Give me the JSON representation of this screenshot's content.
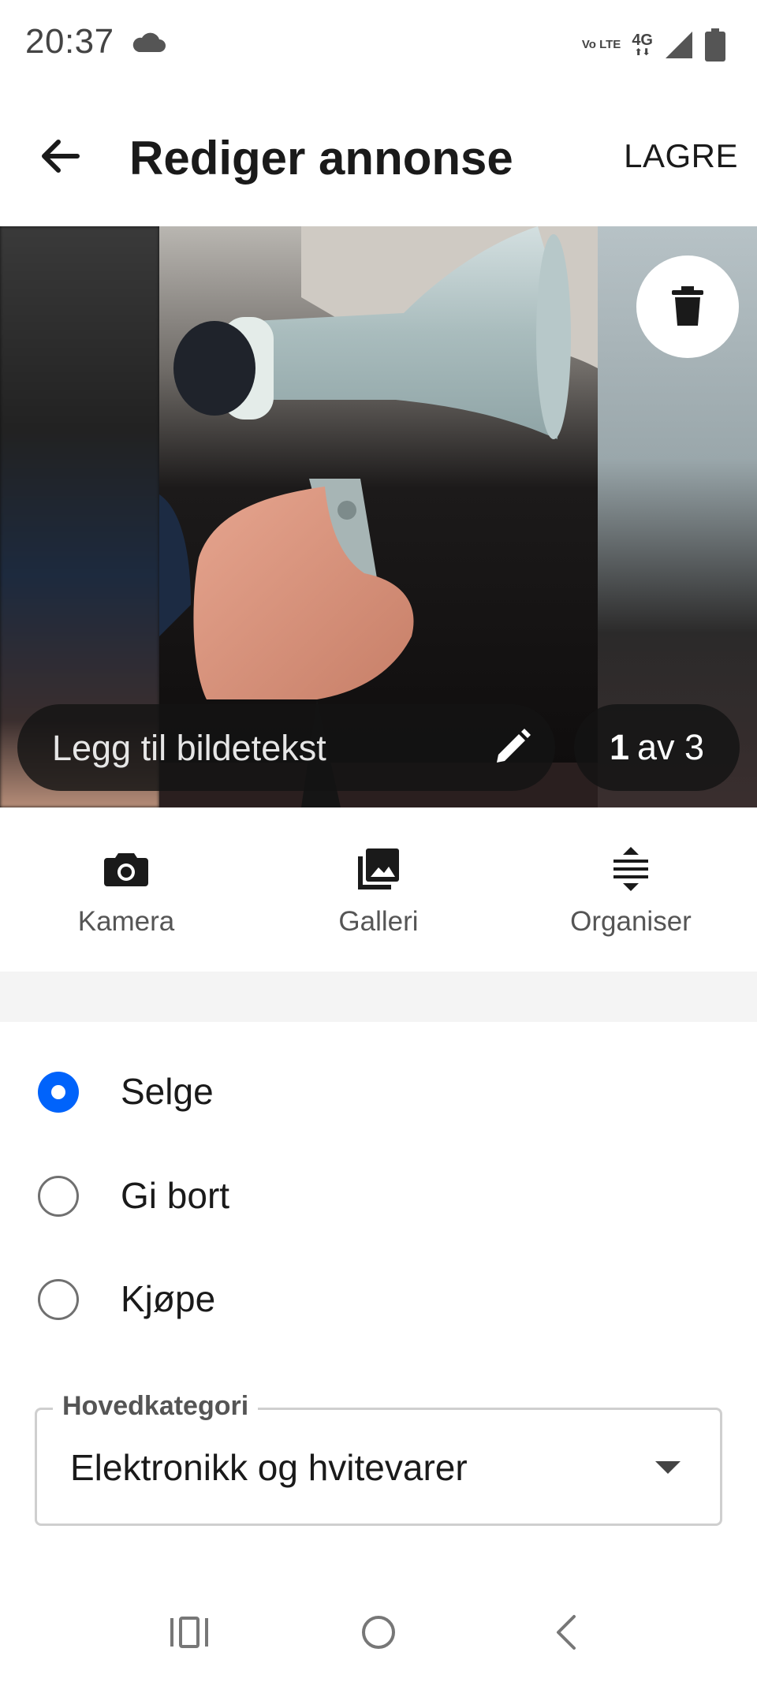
{
  "status_bar": {
    "time": "20:37",
    "volte_label": "Vo LTE",
    "network_label": "4G"
  },
  "app_bar": {
    "title": "Rediger annonse",
    "save_label": "LAGRE"
  },
  "carousel": {
    "caption_placeholder": "Legg til bildetekst",
    "current": "1",
    "counter_suffix": "av 3"
  },
  "photo_actions": [
    {
      "label": "Kamera",
      "icon": "camera-icon"
    },
    {
      "label": "Galleri",
      "icon": "gallery-icon"
    },
    {
      "label": "Organiser",
      "icon": "reorder-icon"
    }
  ],
  "ad_type": {
    "selected": "Selge",
    "options": [
      {
        "label": "Selge"
      },
      {
        "label": "Gi bort"
      },
      {
        "label": "Kjøpe"
      }
    ]
  },
  "category": {
    "label": "Hovedkategori",
    "value": "Elektronikk og hvitevarer"
  },
  "colors": {
    "accent": "#0063fb",
    "text": "#1a1a1a",
    "muted": "#555555"
  }
}
